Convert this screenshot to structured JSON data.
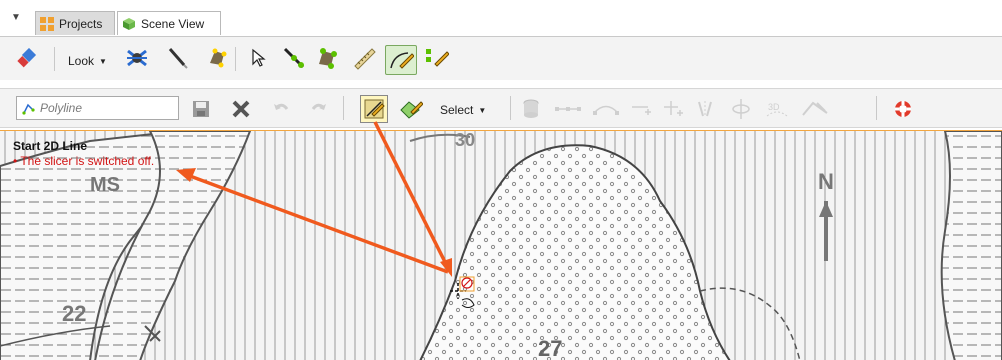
{
  "tabs": [
    {
      "label": "Projects",
      "icon": "grid-icon",
      "active": false
    },
    {
      "label": "Scene View",
      "icon": "cube-icon",
      "active": true
    }
  ],
  "toolbar1": {
    "look_label": "Look"
  },
  "toolbar2": {
    "polyline_placeholder": "Polyline",
    "select_label": "Select"
  },
  "scene": {
    "message_title": "Start 2D Line",
    "message_error": "• The slicer is switched off."
  },
  "colors": {
    "accent_arrow": "#f05a1e",
    "error_text": "#d21414",
    "scene_border": "#f2a640"
  }
}
